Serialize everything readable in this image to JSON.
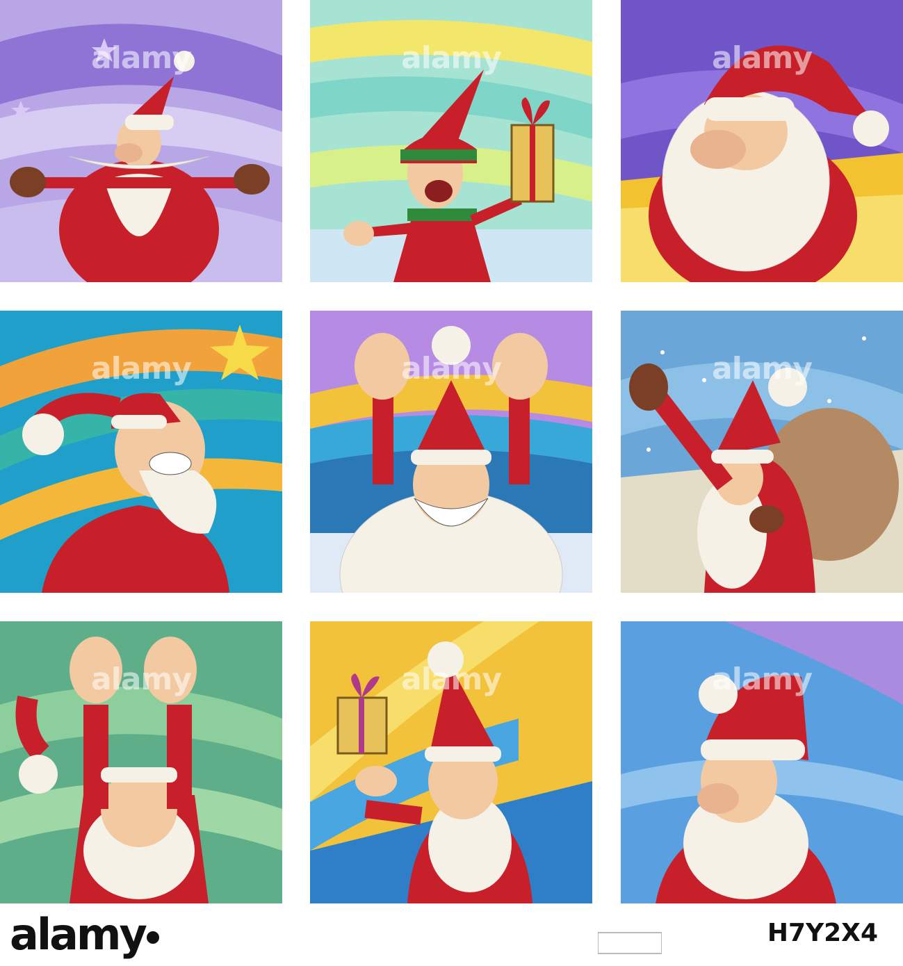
{
  "watermark": "alamy",
  "footer": {
    "logo": "alamy",
    "image_code": "H7Y2X4"
  },
  "colors": {
    "santa_red": "#c8202a",
    "beard_white": "#f6f1e6",
    "skin": "#f2c9a0",
    "mitten_brown": "#7a3f24"
  },
  "tiles": [
    {
      "subject": "santa-arms-open"
    },
    {
      "subject": "elf-with-gift"
    },
    {
      "subject": "santa-closeup"
    },
    {
      "subject": "santa-grinning-stars"
    },
    {
      "subject": "santa-arms-raised"
    },
    {
      "subject": "santa-with-sack"
    },
    {
      "subject": "santa-hands-up"
    },
    {
      "subject": "santa-with-gift"
    },
    {
      "subject": "santa-portrait"
    }
  ]
}
